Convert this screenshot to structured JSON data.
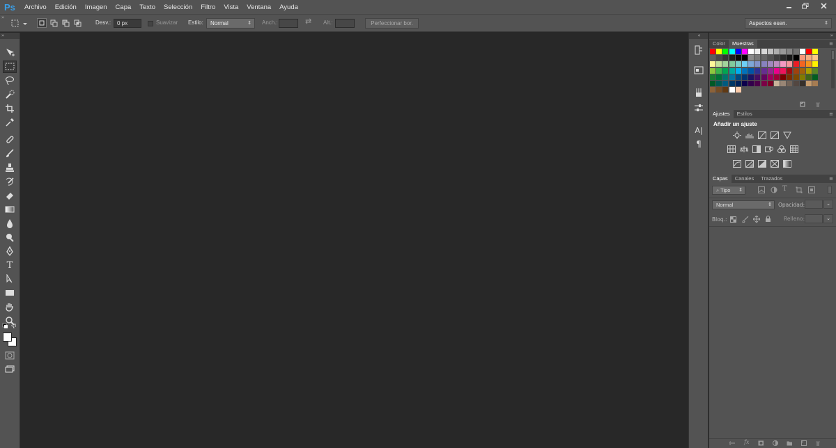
{
  "app": {
    "logo": "Ps"
  },
  "menubar": {
    "items": [
      "Archivo",
      "Edición",
      "Imagen",
      "Capa",
      "Texto",
      "Selección",
      "Filtro",
      "Vista",
      "Ventana",
      "Ayuda"
    ]
  },
  "options": {
    "feather_label": "Desv.:",
    "feather_value": "0 px",
    "antialias_label": "Suavizar",
    "style_label": "Estilo:",
    "style_value": "Normal",
    "width_label": "Anch.:",
    "height_label": "Alt.:",
    "refine_label": "Perfeccionar bor.",
    "workspace_value": "Aspectos esen."
  },
  "colors": {
    "accent": "#3a9fe8",
    "chrome": "#535353",
    "canvas": "#282828"
  },
  "panels": {
    "color_tabs": [
      "Color",
      "Muestras"
    ],
    "adjust_tabs": [
      "Ajustes",
      "Estilos"
    ],
    "adjust_title": "Añadir un ajuste",
    "layer_tabs": [
      "Capas",
      "Canales",
      "Trazados"
    ],
    "filter_type": "Tipo",
    "blend_mode": "Normal",
    "opacity_label": "Opacidad:",
    "lock_label": "Bloq.:",
    "fill_label": "Relleno:"
  },
  "swatches": [
    [
      "#ff0000",
      "#ffff00",
      "#00ff00",
      "#00ffff",
      "#0000ff",
      "#ff00ff",
      "#ffffff",
      "#ebebeb",
      "#d6d6d6",
      "#c2c2c2",
      "#adadad",
      "#999999",
      "#858585",
      "#707070",
      "#ffffff",
      "#ff0000",
      "#ffff00"
    ],
    [
      "#5c5c5c",
      "#474747",
      "#333333",
      "#1f1f1f",
      "#0a0a0a",
      "#000000",
      "#8a8a8a",
      "#777777",
      "#646464",
      "#515151",
      "#3e3e3e",
      "#2b2b2b",
      "#181818",
      "#000000",
      "#f7977a",
      "#f9ad81",
      "#fdc68a"
    ],
    [
      "#fff79a",
      "#c4df9b",
      "#a3d39c",
      "#82ca9d",
      "#7bcdc8",
      "#6ecff6",
      "#7ea7d8",
      "#8493ca",
      "#8882be",
      "#a187be",
      "#bc8dbf",
      "#f49ac2",
      "#f6989d",
      "#ed1c24",
      "#f26522",
      "#f7941d",
      "#fff200"
    ],
    [
      "#8dc73f",
      "#39b54a",
      "#00a651",
      "#00a99d",
      "#00aeef",
      "#0072bc",
      "#0054a6",
      "#2e3192",
      "#662d91",
      "#92278f",
      "#ec008c",
      "#ed145b",
      "#9e0b0f",
      "#a0410d",
      "#a36209",
      "#aba000",
      "#598527"
    ],
    [
      "#197b30",
      "#007236",
      "#00746b",
      "#0076a3",
      "#004b80",
      "#003471",
      "#1b1464",
      "#440e62",
      "#630460",
      "#9e005d",
      "#9e0039",
      "#790000",
      "#7b2e00",
      "#7d4900",
      "#827b00",
      "#406618",
      "#005e20"
    ],
    [
      "#005826",
      "#005952",
      "#005b7f",
      "#003663",
      "#002157",
      "#0d004c",
      "#32004b",
      "#4b0049",
      "#7b0046",
      "#7a0026",
      "#c7b299",
      "#998675",
      "#736357",
      "#534741",
      "#37302a",
      "#c69c6d",
      "#a67c52"
    ],
    [
      "#8c6239",
      "#754c24",
      "#603913",
      "#ffffff",
      "#f9c9a8"
    ]
  ]
}
